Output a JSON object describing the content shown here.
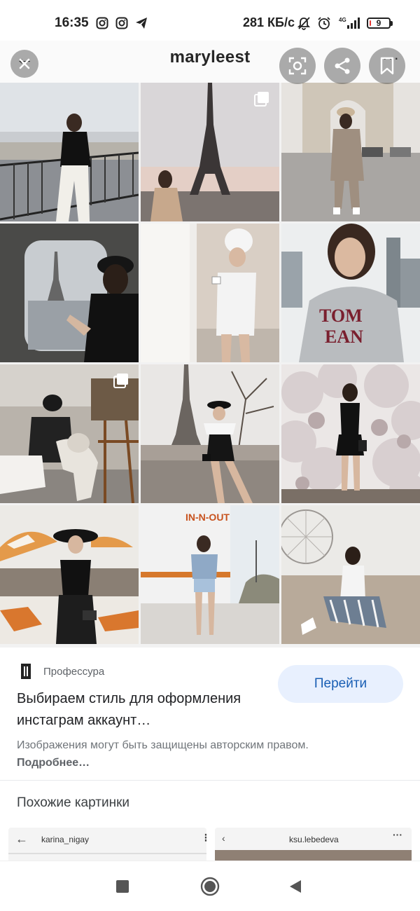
{
  "status_bar": {
    "time": "16:35",
    "left_icons": [
      "instagram-icon",
      "instagram-icon",
      "telegram-icon"
    ],
    "net_speed": "281 КБ/с",
    "right_icons": [
      "bell-muted-icon",
      "alarm-icon",
      "signal-4g-icon"
    ],
    "network_type": "4G",
    "battery_level": "9",
    "battery_color": "#e53935"
  },
  "preview": {
    "username": "maryleest",
    "overlay_buttons": [
      "close-icon",
      "lens-icon",
      "share-icon",
      "bookmark-icon"
    ],
    "grid_images": [
      "woman-on-balcony-paris",
      "woman-with-eiffel-tower",
      "woman-at-arc-de-triomphe",
      "woman-in-train-window",
      "woman-in-towel-with-coffee",
      "woman-in-gray-sweatshirt",
      "woman-with-husky-cafe",
      "woman-on-wall-eiffel-tower",
      "woman-under-blossom-tree",
      "woman-in-hat-beach",
      "woman-at-in-n-out",
      "woman-by-ferris-wheel"
    ]
  },
  "result": {
    "source": "Профессура",
    "go_button": "Перейти",
    "title": "Выбираем стиль для оформления инстаграм аккаунт…",
    "copyright_text": "Изображения могут быть защищены авторским правом.",
    "more_link": "Подробнее…"
  },
  "similar": {
    "heading": "Похожие картинки",
    "items": [
      {
        "username": "karina_nigay"
      },
      {
        "username": "ksu.lebedeva"
      }
    ]
  },
  "colors": {
    "accent": "#1a5fb4",
    "accent_bg": "#e8f0fe"
  }
}
